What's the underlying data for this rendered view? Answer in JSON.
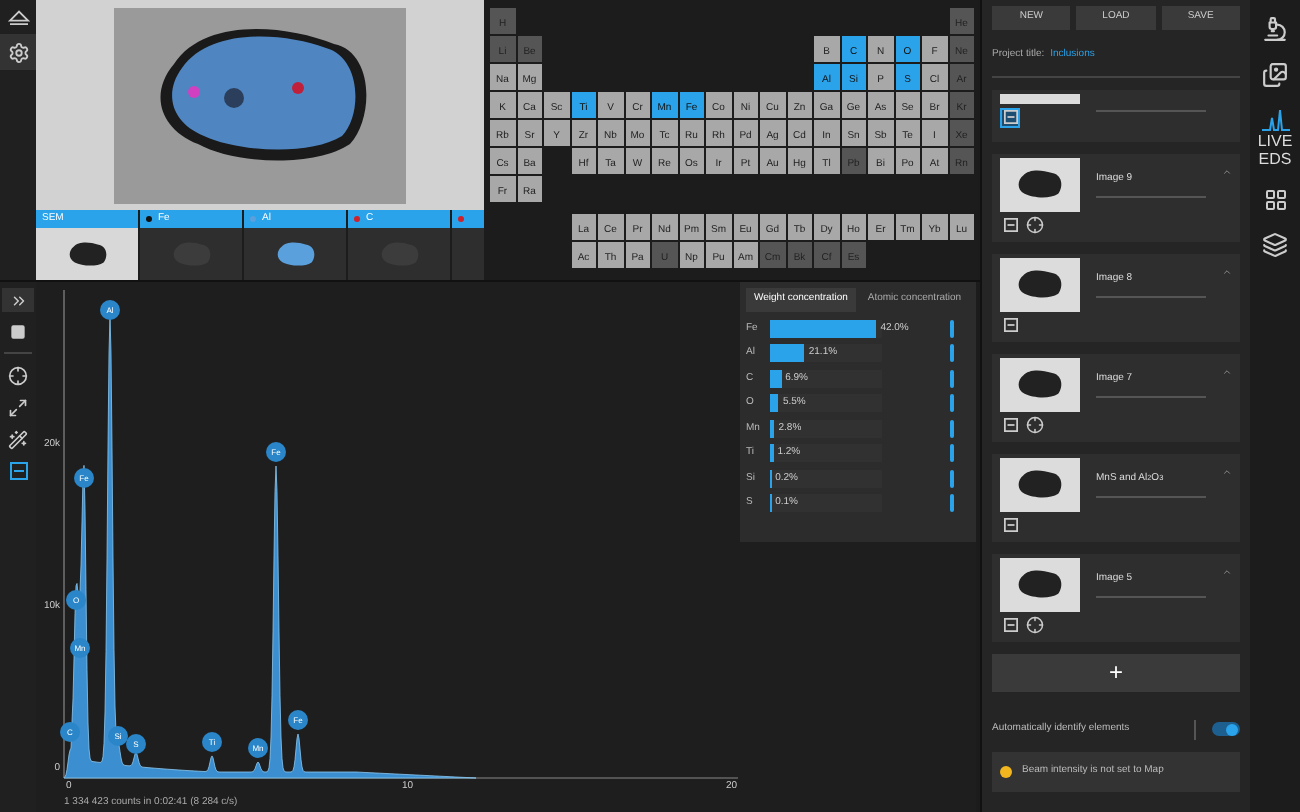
{
  "image_strip": [
    {
      "kind": "sem",
      "label": "SEM"
    },
    {
      "kind": "element",
      "label": "Fe",
      "color": "#111111"
    },
    {
      "kind": "element",
      "label": "Al",
      "color": "#5aa0dc"
    },
    {
      "kind": "element",
      "label": "C",
      "color": "#d0202a"
    },
    {
      "kind": "element",
      "color": "#d0202a"
    }
  ],
  "periodic_table": {
    "rows": [
      {
        "left": [
          {
            "symbol": "H",
            "selected": false,
            "available": false
          }
        ],
        "right": [
          {
            "symbol": "He",
            "selected": false,
            "available": false
          }
        ]
      },
      {
        "left": [
          {
            "symbol": "Li",
            "selected": false,
            "available": false
          },
          {
            "symbol": "Be",
            "selected": false,
            "available": false
          }
        ],
        "right": [
          {
            "symbol": "B",
            "selected": false,
            "available": true
          },
          {
            "symbol": "C",
            "selected": true,
            "available": true
          },
          {
            "symbol": "N",
            "selected": false,
            "available": true
          },
          {
            "symbol": "O",
            "selected": true,
            "available": true
          },
          {
            "symbol": "F",
            "selected": false,
            "available": true
          },
          {
            "symbol": "Ne",
            "selected": false,
            "available": false
          }
        ]
      },
      {
        "left": [
          {
            "symbol": "Na",
            "selected": false,
            "available": true
          },
          {
            "symbol": "Mg",
            "selected": false,
            "available": true
          }
        ],
        "right": [
          {
            "symbol": "Al",
            "selected": true,
            "available": true
          },
          {
            "symbol": "Si",
            "selected": true,
            "available": true
          },
          {
            "symbol": "P",
            "selected": false,
            "available": true
          },
          {
            "symbol": "S",
            "selected": true,
            "available": true
          },
          {
            "symbol": "Cl",
            "selected": false,
            "available": true
          },
          {
            "symbol": "Ar",
            "selected": false,
            "available": false
          }
        ]
      },
      {
        "left": [
          {
            "symbol": "K",
            "selected": false,
            "available": true
          },
          {
            "symbol": "Ca",
            "selected": false,
            "available": true
          },
          {
            "symbol": "Sc",
            "selected": false,
            "available": true
          },
          {
            "symbol": "Ti",
            "selected": true,
            "available": true
          },
          {
            "symbol": "V",
            "selected": false,
            "available": true
          },
          {
            "symbol": "Cr",
            "selected": false,
            "available": true
          },
          {
            "symbol": "Mn",
            "selected": true,
            "available": true
          },
          {
            "symbol": "Fe",
            "selected": true,
            "available": true
          },
          {
            "symbol": "Co",
            "selected": false,
            "available": true
          },
          {
            "symbol": "Ni",
            "selected": false,
            "available": true
          },
          {
            "symbol": "Cu",
            "selected": false,
            "available": true
          },
          {
            "symbol": "Zn",
            "selected": false,
            "available": true
          },
          {
            "symbol": "Ga",
            "selected": false,
            "available": true
          },
          {
            "symbol": "Ge",
            "selected": false,
            "available": true
          },
          {
            "symbol": "As",
            "selected": false,
            "available": true
          },
          {
            "symbol": "Se",
            "selected": false,
            "available": true
          },
          {
            "symbol": "Br",
            "selected": false,
            "available": true
          },
          {
            "symbol": "Kr",
            "selected": false,
            "available": false
          }
        ]
      },
      {
        "left": [
          {
            "symbol": "Rb",
            "selected": false,
            "available": true
          },
          {
            "symbol": "Sr",
            "selected": false,
            "available": true
          },
          {
            "symbol": "Y",
            "selected": false,
            "available": true
          },
          {
            "symbol": "Zr",
            "selected": false,
            "available": true
          },
          {
            "symbol": "Nb",
            "selected": false,
            "available": true
          },
          {
            "symbol": "Mo",
            "selected": false,
            "available": true
          },
          {
            "symbol": "Tc",
            "selected": false,
            "available": true
          },
          {
            "symbol": "Ru",
            "selected": false,
            "available": true
          },
          {
            "symbol": "Rh",
            "selected": false,
            "available": true
          },
          {
            "symbol": "Pd",
            "selected": false,
            "available": true
          },
          {
            "symbol": "Ag",
            "selected": false,
            "available": true
          },
          {
            "symbol": "Cd",
            "selected": false,
            "available": true
          },
          {
            "symbol": "In",
            "selected": false,
            "available": true
          },
          {
            "symbol": "Sn",
            "selected": false,
            "available": true
          },
          {
            "symbol": "Sb",
            "selected": false,
            "available": true
          },
          {
            "symbol": "Te",
            "selected": false,
            "available": true
          },
          {
            "symbol": "I",
            "selected": false,
            "available": true
          },
          {
            "symbol": "Xe",
            "selected": false,
            "available": false
          }
        ]
      },
      {
        "left": [
          {
            "symbol": "Cs",
            "selected": false,
            "available": true
          },
          {
            "symbol": "Ba",
            "selected": false,
            "available": true
          }
        ],
        "right": [
          {
            "symbol": "Hf",
            "selected": false,
            "available": true
          },
          {
            "symbol": "Ta",
            "selected": false,
            "available": true
          },
          {
            "symbol": "W",
            "selected": false,
            "available": true
          },
          {
            "symbol": "Re",
            "selected": false,
            "available": true
          },
          {
            "symbol": "Os",
            "selected": false,
            "available": true
          },
          {
            "symbol": "Ir",
            "selected": false,
            "available": true
          },
          {
            "symbol": "Pt",
            "selected": false,
            "available": true
          },
          {
            "symbol": "Au",
            "selected": false,
            "available": true
          },
          {
            "symbol": "Hg",
            "selected": false,
            "available": true
          },
          {
            "symbol": "Tl",
            "selected": false,
            "available": true
          },
          {
            "symbol": "Pb",
            "selected": false,
            "available": false
          },
          {
            "symbol": "Bi",
            "selected": false,
            "available": true
          },
          {
            "symbol": "Po",
            "selected": false,
            "available": true
          },
          {
            "symbol": "At",
            "selected": false,
            "available": true
          },
          {
            "symbol": "Rn",
            "selected": false,
            "available": false
          }
        ]
      },
      {
        "left": [
          {
            "symbol": "Fr",
            "selected": false,
            "available": true
          },
          {
            "symbol": "Ra",
            "selected": false,
            "available": true
          }
        ]
      }
    ],
    "lanthanides": [
      {
        "symbol": "La",
        "selected": false,
        "available": true
      },
      {
        "symbol": "Ce",
        "selected": false,
        "available": true
      },
      {
        "symbol": "Pr",
        "selected": false,
        "available": true
      },
      {
        "symbol": "Nd",
        "selected": false,
        "available": true
      },
      {
        "symbol": "Pm",
        "selected": false,
        "available": true
      },
      {
        "symbol": "Sm",
        "selected": false,
        "available": true
      },
      {
        "symbol": "Eu",
        "selected": false,
        "available": true
      },
      {
        "symbol": "Gd",
        "selected": false,
        "available": true
      },
      {
        "symbol": "Tb",
        "selected": false,
        "available": true
      },
      {
        "symbol": "Dy",
        "selected": false,
        "available": true
      },
      {
        "symbol": "Ho",
        "selected": false,
        "available": true
      },
      {
        "symbol": "Er",
        "selected": false,
        "available": true
      },
      {
        "symbol": "Tm",
        "selected": false,
        "available": true
      },
      {
        "symbol": "Yb",
        "selected": false,
        "available": true
      },
      {
        "symbol": "Lu",
        "selected": false,
        "available": true
      }
    ],
    "actinides": [
      {
        "symbol": "Ac",
        "selected": false,
        "available": true
      },
      {
        "symbol": "Th",
        "selected": false,
        "available": true
      },
      {
        "symbol": "Pa",
        "selected": false,
        "available": true
      },
      {
        "symbol": "U",
        "selected": false,
        "available": false
      },
      {
        "symbol": "Np",
        "selected": false,
        "available": true
      },
      {
        "symbol": "Pu",
        "selected": false,
        "available": true
      },
      {
        "symbol": "Am",
        "selected": false,
        "available": true
      },
      {
        "symbol": "Cm",
        "selected": false,
        "available": false
      },
      {
        "symbol": "Bk",
        "selected": false,
        "available": false
      },
      {
        "symbol": "Cf",
        "selected": false,
        "available": false
      },
      {
        "symbol": "Es",
        "selected": false,
        "available": false
      }
    ]
  },
  "spectrum": {
    "yticks": [
      "20k",
      "10k",
      "0"
    ],
    "xticks": [
      "0",
      "10",
      "20"
    ],
    "peaks": [
      {
        "label": "C"
      },
      {
        "label": "O"
      },
      {
        "label": "Mn"
      },
      {
        "label": "Fe"
      },
      {
        "label": "Al"
      },
      {
        "label": "Si"
      },
      {
        "label": "S"
      },
      {
        "label": "Ti"
      },
      {
        "label": "Mn"
      },
      {
        "label": "Fe"
      },
      {
        "label": "Fe"
      }
    ],
    "counts": "1 334 423 counts in 0:02:41 (8 284 c/s)"
  },
  "concentration": {
    "tabs": [
      {
        "label": "Weight concentration",
        "selected": true
      },
      {
        "label": "Atomic concentration",
        "selected": false
      }
    ],
    "rows": [
      {
        "element": "Fe",
        "value": "42.0%",
        "level": 0.95
      },
      {
        "element": "Al",
        "value": "21.1%",
        "level": 0.31
      },
      {
        "element": "C",
        "value": "6.9%",
        "level": 0.1
      },
      {
        "element": "O",
        "value": "5.5%",
        "level": 0.08
      },
      {
        "element": "Mn",
        "value": "2.8%",
        "level": 0.04
      },
      {
        "element": "Ti",
        "value": "1.2%",
        "level": 0.03
      },
      {
        "element": "Si",
        "value": "0.2%",
        "level": 0.01
      },
      {
        "element": "S",
        "value": "0.1%",
        "level": 0.01
      }
    ]
  },
  "project": {
    "buttons": [
      "NEW",
      "LOAD",
      "SAVE"
    ],
    "title_label": "Project title:",
    "title": "Inclusions",
    "cards": [
      {
        "selected": true,
        "kind": "partial"
      },
      {
        "title": "Image 9",
        "selected": false,
        "kind": "full"
      },
      {
        "title": "Image 8",
        "selected": false,
        "kind": "full"
      },
      {
        "title": "Image 7",
        "selected": false,
        "kind": "full"
      },
      {
        "title": "MnS and Al$_{2}$O$_{3}$",
        "selected": false,
        "kind": "full"
      },
      {
        "title": "Image 5",
        "selected": false,
        "kind": "full"
      }
    ],
    "add_button": "+",
    "auto_identify": {
      "label": "Automatically identify elements",
      "on": true
    },
    "warning": {
      "text": "Beam intensity is not set to Map",
      "color": "#f2b61f"
    }
  },
  "side_nav": {
    "live_label": "LIVE EDS"
  }
}
